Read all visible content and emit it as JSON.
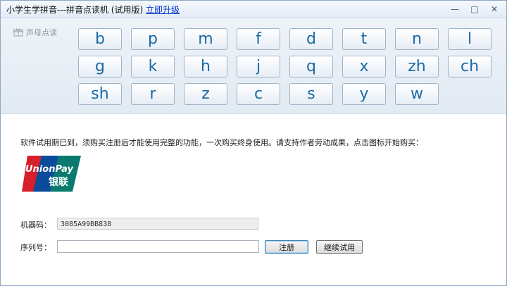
{
  "window": {
    "title": "小学生学拼音---拼音点读机 (试用版)",
    "upgrade_link": "立即升级",
    "controls": {
      "minimize": "—",
      "maximize": "□",
      "close": "✕"
    }
  },
  "sidebar": {
    "icon": "gift-icon",
    "label": "声母点读"
  },
  "initials": [
    "b",
    "p",
    "m",
    "f",
    "d",
    "t",
    "n",
    "l",
    "g",
    "k",
    "h",
    "j",
    "q",
    "x",
    "zh",
    "ch",
    "sh",
    "r",
    "z",
    "c",
    "s",
    "y",
    "w"
  ],
  "notice": "软件试用期已到，须购买注册后才能使用完整的功能，一次购买终身使用。请支持作者劳动成果，点击图标开始购买：",
  "payment_logo": {
    "text_en": "UnionPay",
    "text_cn": "银联",
    "colors": [
      "#d7202a",
      "#0a4c9b",
      "#0a7a6e"
    ]
  },
  "registration": {
    "machine_label": "机器码：",
    "machine_code": "3085A99BB838",
    "serial_label": "序列号：",
    "serial_value": "",
    "register_button": "注册",
    "trial_button": "继续试用"
  }
}
